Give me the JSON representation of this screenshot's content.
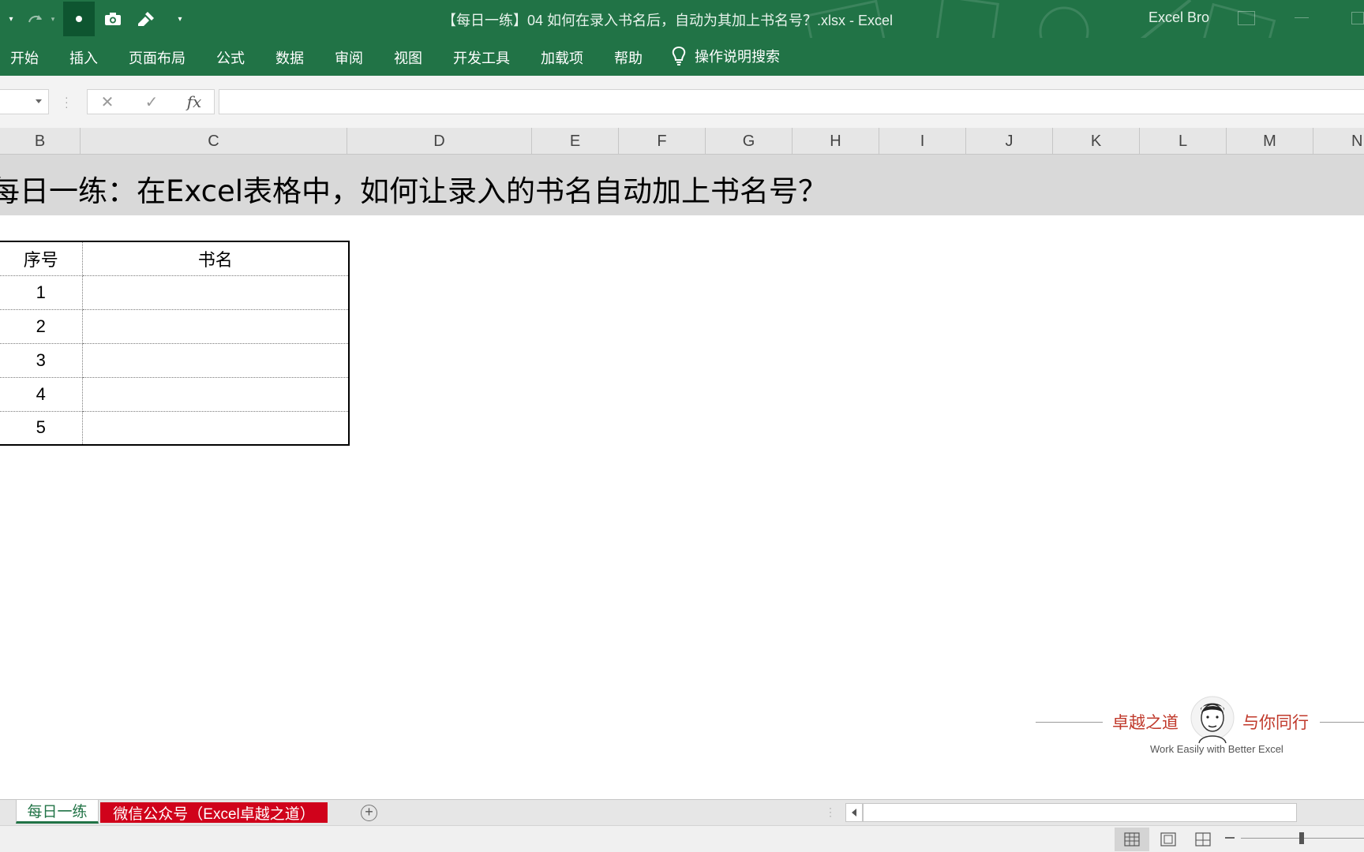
{
  "window": {
    "title": "【每日一练】04 如何在录入书名后，自动为其加上书名号？.xlsx  -  Excel",
    "user": "Excel Bro"
  },
  "ribbon": {
    "tabs": [
      "开始",
      "插入",
      "页面布局",
      "公式",
      "数据",
      "审阅",
      "视图",
      "开发工具",
      "加载项",
      "帮助"
    ],
    "tell_me": "操作说明搜索"
  },
  "formula_bar": {
    "fx_label": "fx",
    "cancel_symbol": "✕",
    "enter_symbol": "✓",
    "value": ""
  },
  "columns": [
    "B",
    "C",
    "D",
    "E",
    "F",
    "G",
    "H",
    "I",
    "J",
    "K",
    "L",
    "M",
    "N"
  ],
  "sheet": {
    "title": "每日一练：在Excel表格中，如何让录入的书名自动加上书名号？",
    "table": {
      "headers": [
        "序号",
        "书名"
      ],
      "rows": [
        [
          "1",
          ""
        ],
        [
          "2",
          ""
        ],
        [
          "3",
          ""
        ],
        [
          "4",
          ""
        ],
        [
          "5",
          ""
        ]
      ]
    }
  },
  "brand": {
    "left_text": "卓越之道",
    "right_text": "与你同行",
    "tagline": "Work Easily with Better Excel"
  },
  "sheet_tabs": {
    "active": "每日一练",
    "second": "微信公众号（Excel卓越之道）",
    "add_symbol": "+"
  },
  "colors": {
    "excel_green": "#217346",
    "tab_red": "#d0021b",
    "brand_red": "#c0392b"
  }
}
